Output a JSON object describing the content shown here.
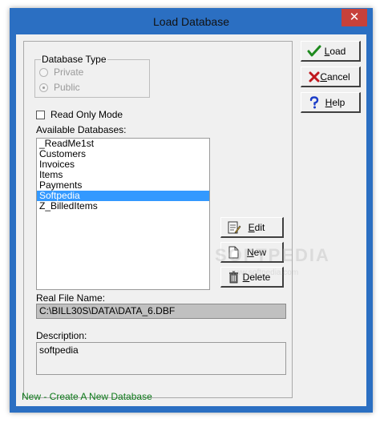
{
  "window": {
    "title": "Load Database",
    "close_glyph": "✕"
  },
  "database_type": {
    "legend": "Database Type",
    "options": [
      {
        "label": "Private",
        "checked": false
      },
      {
        "label": "Public",
        "checked": true
      }
    ]
  },
  "read_only": {
    "label": "Read Only Mode",
    "checked": false
  },
  "available": {
    "label": "Available Databases:",
    "items": [
      "_ReadMe1st",
      "Customers",
      "Invoices",
      "Items",
      "Payments",
      "Softpedia",
      "Z_BilledItems"
    ],
    "selected_index": 5
  },
  "buttons": {
    "load": {
      "label": "Load",
      "icon": "checkmark-icon"
    },
    "cancel": {
      "label": "Cancel",
      "icon": "x-icon"
    },
    "help": {
      "label": "Help",
      "icon": "question-icon"
    },
    "edit": {
      "label": "Edit",
      "icon": "edit-document-icon"
    },
    "new": {
      "label": "New",
      "icon": "new-document-icon"
    },
    "delete": {
      "label": "Delete",
      "icon": "trash-icon"
    }
  },
  "real_file": {
    "label": "Real File Name:",
    "value": "C:\\BILL30S\\DATA\\DATA_6.DBF"
  },
  "description": {
    "label": "Description:",
    "value": "softpedia"
  },
  "status_text": "New - Create A New Database",
  "watermark": {
    "main": "SOFTPEDIA",
    "sub": "www.softpedia.com"
  },
  "colors": {
    "frame": "#2b6fc2",
    "close": "#c7413a",
    "selection": "#3399ff",
    "status": "#0e7a1a",
    "load_check": "#1e8a1e",
    "cancel_x": "#c0181e",
    "help_q": "#1a3cc8"
  }
}
